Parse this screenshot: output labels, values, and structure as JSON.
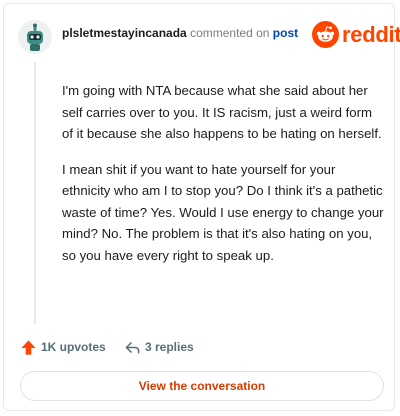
{
  "header": {
    "username": "plsletmestayincanada",
    "action_text": " commented on ",
    "target": "post"
  },
  "brand": {
    "wordmark": "reddit",
    "color": "#ff4500"
  },
  "comment": {
    "paragraphs": [
      "I'm going with NTA because what she said about her self carries over to you. It IS racism, just a weird form of it because she also happens to be hating on herself.",
      "I mean shit if you want to hate yourself for your ethnicity who am I to stop you? Do I think it's a pathetic waste of time? Yes. Would I use energy to change your mind? No. The problem is that it's also hating on you, so you have every right to speak up."
    ]
  },
  "stats": {
    "upvotes": "1K upvotes",
    "replies": "3 replies",
    "upvote_color": "#ff4500"
  },
  "cta": {
    "label": "View the conversation"
  },
  "icons": {
    "avatar": "snoo-avatar-icon",
    "upvote": "upvote-arrow-icon",
    "reply": "reply-arrow-icon",
    "logo": "reddit-snoo-icon"
  }
}
